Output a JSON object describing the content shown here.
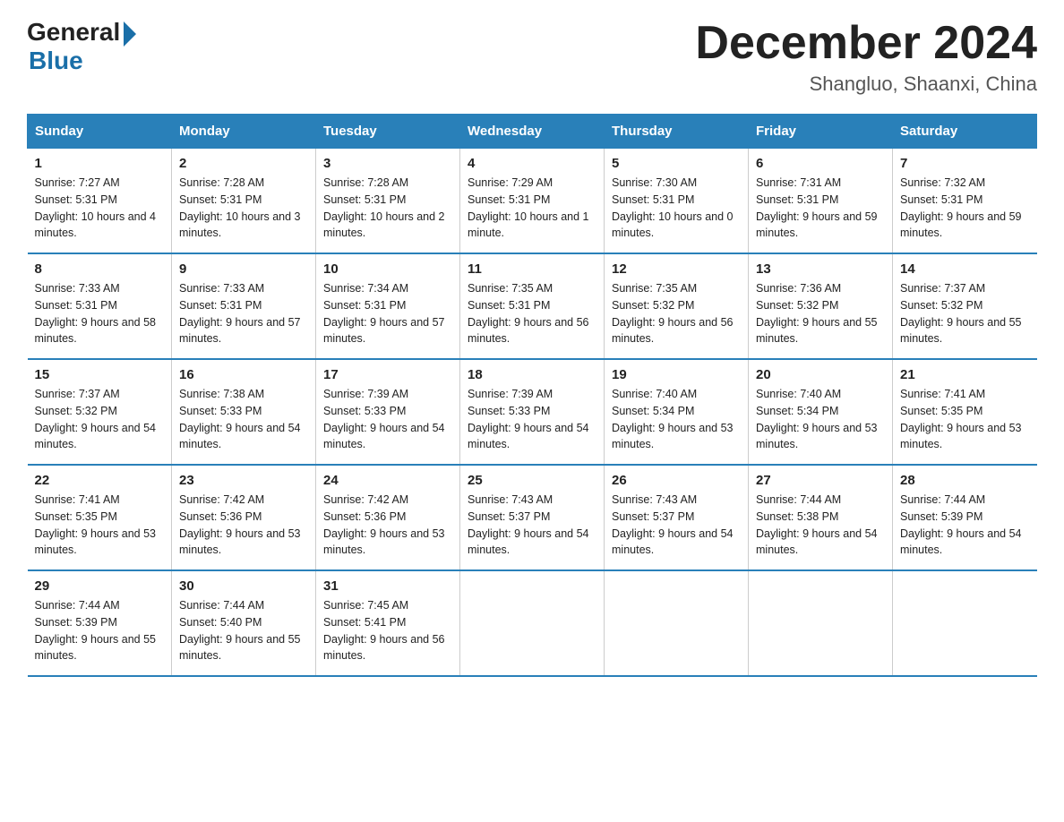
{
  "logo": {
    "general": "General",
    "blue": "Blue"
  },
  "header": {
    "month": "December 2024",
    "location": "Shangluo, Shaanxi, China"
  },
  "days_of_week": [
    "Sunday",
    "Monday",
    "Tuesday",
    "Wednesday",
    "Thursday",
    "Friday",
    "Saturday"
  ],
  "weeks": [
    [
      {
        "day": "1",
        "sunrise": "7:27 AM",
        "sunset": "5:31 PM",
        "daylight": "10 hours and 4 minutes."
      },
      {
        "day": "2",
        "sunrise": "7:28 AM",
        "sunset": "5:31 PM",
        "daylight": "10 hours and 3 minutes."
      },
      {
        "day": "3",
        "sunrise": "7:28 AM",
        "sunset": "5:31 PM",
        "daylight": "10 hours and 2 minutes."
      },
      {
        "day": "4",
        "sunrise": "7:29 AM",
        "sunset": "5:31 PM",
        "daylight": "10 hours and 1 minute."
      },
      {
        "day": "5",
        "sunrise": "7:30 AM",
        "sunset": "5:31 PM",
        "daylight": "10 hours and 0 minutes."
      },
      {
        "day": "6",
        "sunrise": "7:31 AM",
        "sunset": "5:31 PM",
        "daylight": "9 hours and 59 minutes."
      },
      {
        "day": "7",
        "sunrise": "7:32 AM",
        "sunset": "5:31 PM",
        "daylight": "9 hours and 59 minutes."
      }
    ],
    [
      {
        "day": "8",
        "sunrise": "7:33 AM",
        "sunset": "5:31 PM",
        "daylight": "9 hours and 58 minutes."
      },
      {
        "day": "9",
        "sunrise": "7:33 AM",
        "sunset": "5:31 PM",
        "daylight": "9 hours and 57 minutes."
      },
      {
        "day": "10",
        "sunrise": "7:34 AM",
        "sunset": "5:31 PM",
        "daylight": "9 hours and 57 minutes."
      },
      {
        "day": "11",
        "sunrise": "7:35 AM",
        "sunset": "5:31 PM",
        "daylight": "9 hours and 56 minutes."
      },
      {
        "day": "12",
        "sunrise": "7:35 AM",
        "sunset": "5:32 PM",
        "daylight": "9 hours and 56 minutes."
      },
      {
        "day": "13",
        "sunrise": "7:36 AM",
        "sunset": "5:32 PM",
        "daylight": "9 hours and 55 minutes."
      },
      {
        "day": "14",
        "sunrise": "7:37 AM",
        "sunset": "5:32 PM",
        "daylight": "9 hours and 55 minutes."
      }
    ],
    [
      {
        "day": "15",
        "sunrise": "7:37 AM",
        "sunset": "5:32 PM",
        "daylight": "9 hours and 54 minutes."
      },
      {
        "day": "16",
        "sunrise": "7:38 AM",
        "sunset": "5:33 PM",
        "daylight": "9 hours and 54 minutes."
      },
      {
        "day": "17",
        "sunrise": "7:39 AM",
        "sunset": "5:33 PM",
        "daylight": "9 hours and 54 minutes."
      },
      {
        "day": "18",
        "sunrise": "7:39 AM",
        "sunset": "5:33 PM",
        "daylight": "9 hours and 54 minutes."
      },
      {
        "day": "19",
        "sunrise": "7:40 AM",
        "sunset": "5:34 PM",
        "daylight": "9 hours and 53 minutes."
      },
      {
        "day": "20",
        "sunrise": "7:40 AM",
        "sunset": "5:34 PM",
        "daylight": "9 hours and 53 minutes."
      },
      {
        "day": "21",
        "sunrise": "7:41 AM",
        "sunset": "5:35 PM",
        "daylight": "9 hours and 53 minutes."
      }
    ],
    [
      {
        "day": "22",
        "sunrise": "7:41 AM",
        "sunset": "5:35 PM",
        "daylight": "9 hours and 53 minutes."
      },
      {
        "day": "23",
        "sunrise": "7:42 AM",
        "sunset": "5:36 PM",
        "daylight": "9 hours and 53 minutes."
      },
      {
        "day": "24",
        "sunrise": "7:42 AM",
        "sunset": "5:36 PM",
        "daylight": "9 hours and 53 minutes."
      },
      {
        "day": "25",
        "sunrise": "7:43 AM",
        "sunset": "5:37 PM",
        "daylight": "9 hours and 54 minutes."
      },
      {
        "day": "26",
        "sunrise": "7:43 AM",
        "sunset": "5:37 PM",
        "daylight": "9 hours and 54 minutes."
      },
      {
        "day": "27",
        "sunrise": "7:44 AM",
        "sunset": "5:38 PM",
        "daylight": "9 hours and 54 minutes."
      },
      {
        "day": "28",
        "sunrise": "7:44 AM",
        "sunset": "5:39 PM",
        "daylight": "9 hours and 54 minutes."
      }
    ],
    [
      {
        "day": "29",
        "sunrise": "7:44 AM",
        "sunset": "5:39 PM",
        "daylight": "9 hours and 55 minutes."
      },
      {
        "day": "30",
        "sunrise": "7:44 AM",
        "sunset": "5:40 PM",
        "daylight": "9 hours and 55 minutes."
      },
      {
        "day": "31",
        "sunrise": "7:45 AM",
        "sunset": "5:41 PM",
        "daylight": "9 hours and 56 minutes."
      },
      null,
      null,
      null,
      null
    ]
  ],
  "labels": {
    "sunrise": "Sunrise:",
    "sunset": "Sunset:",
    "daylight": "Daylight:"
  }
}
